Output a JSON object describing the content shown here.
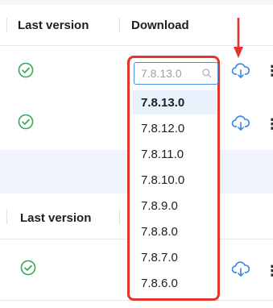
{
  "table": {
    "header_1": {
      "last_version": "Last version",
      "download": "Download"
    },
    "header_2": {
      "last_version": "Last version"
    }
  },
  "dropdown": {
    "search_placeholder": "7.8.13.0",
    "options": [
      "7.8.13.0",
      "7.8.12.0",
      "7.8.11.0",
      "7.8.10.0",
      "7.8.9.0",
      "7.8.8.0",
      "7.8.7.0",
      "7.8.6.0"
    ],
    "selected_index": 0
  },
  "icons": {
    "check": "check-circle-icon",
    "cloud": "cloud-download-icon",
    "kebab": "more-vertical-icon",
    "search": "search-icon",
    "arrow": "red-annotation-arrow"
  },
  "colors": {
    "accent": "#3d8be6",
    "check": "#3aa657",
    "highlight": "#e3342b",
    "selected_bg": "#e9f1fd"
  },
  "kebab_glyph": "⋮"
}
